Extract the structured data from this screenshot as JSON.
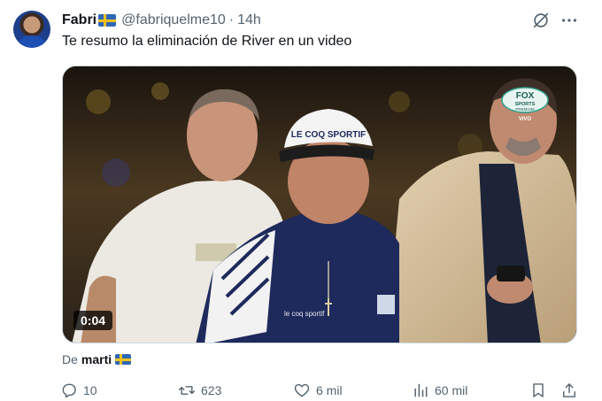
{
  "tweet": {
    "display_name": "Fabri",
    "handle": "@fabriquelme10",
    "separator": "·",
    "time": "14h",
    "text": "Te resumo la eliminación de River en un video"
  },
  "media": {
    "type": "video",
    "duration": "0:04",
    "channel_logo_text": "FOX",
    "channel_sub": "SPORTS",
    "channel_tier": "PREMIUM",
    "live_label": "VIVO",
    "cap_text": "LE COQ SPORTIF",
    "shirt_brand": "le coq sportif"
  },
  "attribution": {
    "prefix": "De",
    "user": "marti"
  },
  "actions": {
    "replies": "10",
    "reposts": "623",
    "likes": "6 mil",
    "views": "60 mil"
  },
  "colors": {
    "text_primary": "#0f1419",
    "text_secondary": "#536471",
    "flag_blue": "#2e68b8",
    "flag_yellow": "#f2c21b"
  },
  "icons": [
    "grok-icon",
    "more-icon",
    "reply-icon",
    "repost-icon",
    "like-icon",
    "views-icon",
    "bookmark-icon",
    "share-icon"
  ]
}
